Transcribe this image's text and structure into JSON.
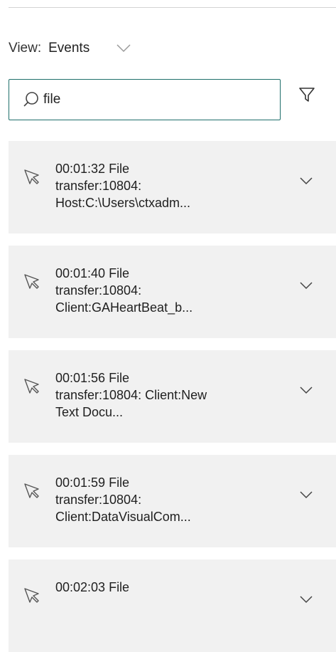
{
  "view": {
    "label": "View:",
    "selected": "Events",
    "icon": "chevron-down-icon"
  },
  "search": {
    "value": "file",
    "icon": "search-icon"
  },
  "filter": {
    "icon": "filter-icon"
  },
  "events": [
    {
      "text": "00:01:32 File\ntransfer:10804:\nHost:C:\\Users\\ctxadm...",
      "icon": "cursor-icon"
    },
    {
      "text": "00:01:40 File\ntransfer:10804:\nClient:GAHeartBeat_b...",
      "icon": "cursor-icon"
    },
    {
      "text": "00:01:56 File\ntransfer:10804: Client:New\nText Docu...",
      "icon": "cursor-icon"
    },
    {
      "text": "00:01:59 File\ntransfer:10804:\nClient:DataVisualCom...",
      "icon": "cursor-icon"
    },
    {
      "text": "00:02:03 File",
      "icon": "cursor-icon"
    }
  ]
}
